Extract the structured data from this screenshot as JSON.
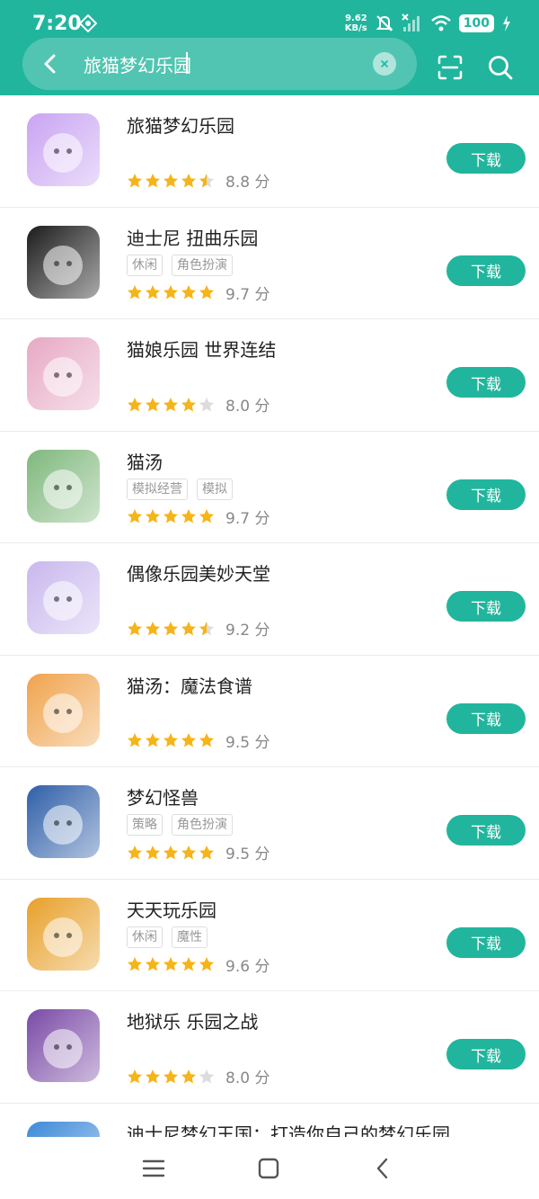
{
  "status_bar": {
    "time": "7:20",
    "net_speed_value": "9.62",
    "net_speed_unit": "KB/s",
    "battery": "100",
    "icons": [
      "settings-gear-icon",
      "mute-bell-icon",
      "no-signal-icon",
      "wifi-icon",
      "charging-icon"
    ]
  },
  "search": {
    "query": "旅猫梦幻乐园",
    "accent_color": "#21b59d"
  },
  "results": [
    {
      "name": "旅猫梦幻乐园",
      "tags": [],
      "stars": 4.5,
      "score": "8.8 分",
      "download": "下载"
    },
    {
      "name": "迪士尼 扭曲乐园",
      "tags": [
        "休闲",
        "角色扮演"
      ],
      "stars": 5,
      "score": "9.7 分",
      "download": "下载"
    },
    {
      "name": "猫娘乐园 世界连结",
      "tags": [],
      "stars": 4,
      "score": "8.0 分",
      "download": "下载"
    },
    {
      "name": "猫汤",
      "tags": [
        "模拟经营",
        "模拟"
      ],
      "stars": 5,
      "score": "9.7 分",
      "download": "下载"
    },
    {
      "name": "偶像乐园美妙天堂",
      "tags": [],
      "stars": 4.5,
      "score": "9.2 分",
      "download": "下载"
    },
    {
      "name": "猫汤：魔法食谱",
      "tags": [],
      "stars": 5,
      "score": "9.5 分",
      "download": "下载"
    },
    {
      "name": "梦幻怪兽",
      "tags": [
        "策略",
        "角色扮演"
      ],
      "stars": 5,
      "score": "9.5 分",
      "download": "下载"
    },
    {
      "name": "天天玩乐园",
      "tags": [
        "休闲",
        "魔性"
      ],
      "stars": 5,
      "score": "9.6 分",
      "download": "下载"
    },
    {
      "name": "地狱乐 乐园之战",
      "tags": [],
      "stars": 4,
      "score": "8.0 分",
      "download": "下载"
    },
    {
      "name": "迪士尼梦幻王国：打造你自己的梦幻乐园",
      "tags": [],
      "stars": 0,
      "score": "",
      "download": ""
    }
  ],
  "icon_colors": [
    "#c9a4f2",
    "#1c1c1c",
    "#e7a9c4",
    "#7fb87c",
    "#c9b8ee",
    "#f0a34c",
    "#2f5fa8",
    "#e8a02a",
    "#7a4aa6",
    "#3d8ad8"
  ]
}
